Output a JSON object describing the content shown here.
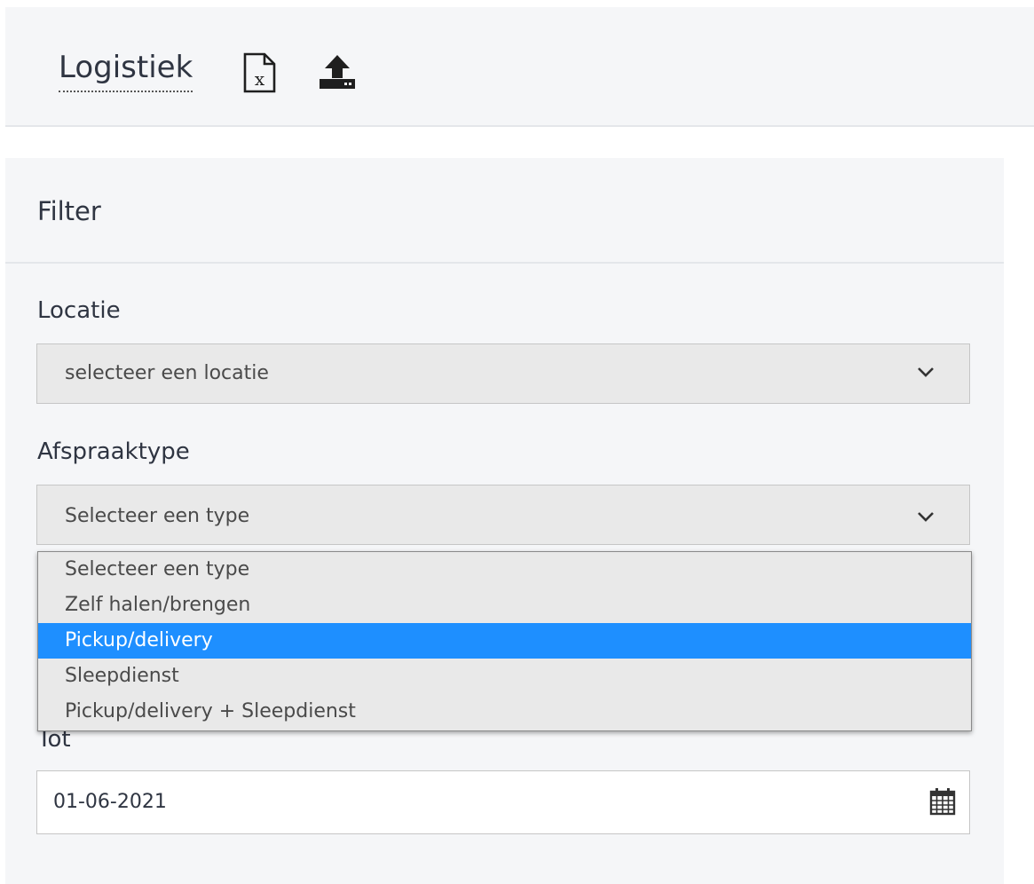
{
  "header": {
    "title": "Logistiek",
    "excel_icon": "excel-file-icon",
    "upload_icon": "upload-icon"
  },
  "filter": {
    "title": "Filter",
    "locatie": {
      "label": "Locatie",
      "selected": "selecteer een locatie"
    },
    "afspraaktype": {
      "label": "Afspraaktype",
      "selected": "Selecteer een type",
      "options": [
        "Selecteer een type",
        "Zelf halen/brengen",
        "Pickup/delivery",
        "Sleepdienst",
        "Pickup/delivery + Sleepdienst"
      ],
      "highlighted_index": 2
    },
    "tot": {
      "label": "Tot",
      "value": "01-06-2021",
      "icon": "calendar-icon"
    }
  },
  "colors": {
    "highlight": "#1e8fff",
    "panel_bg": "#f5f6f8",
    "select_bg": "#e9e9e9",
    "text": "#2f3542"
  }
}
